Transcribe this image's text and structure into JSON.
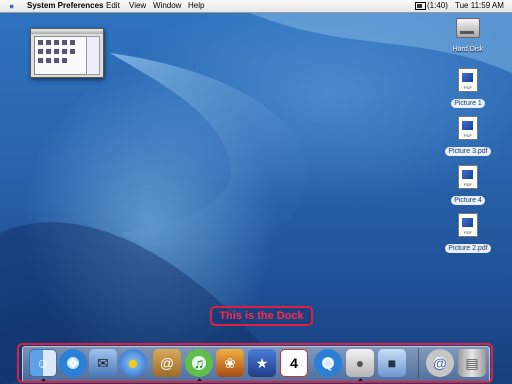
{
  "menubar": {
    "apple_icon": "apple-menu-icon",
    "app_name": "System Preferences",
    "menus": [
      "Edit",
      "View",
      "Window",
      "Help"
    ],
    "battery": "(1:40)",
    "clock": "Tue 11:59 AM"
  },
  "desktop": {
    "icons": [
      {
        "label": "Hard Disk",
        "kind": "hard-disk-icon"
      },
      {
        "label": "Picture 1",
        "kind": "pdf-file-icon"
      },
      {
        "label": "Picture 3.pdf",
        "kind": "pdf-file-icon"
      },
      {
        "label": "Picture 4",
        "kind": "pdf-file-icon"
      },
      {
        "label": "Picture 2.pdf",
        "kind": "pdf-file-icon"
      }
    ]
  },
  "callout": {
    "text": "This is the Dock",
    "color": "#e0203c"
  },
  "dock": {
    "apps": [
      "finder-icon",
      "safari-icon",
      "mail-icon",
      "ichat-icon",
      "address-book-icon",
      "itunes-icon",
      "iphoto-icon",
      "imovie-icon",
      "ical-icon",
      "quicktime-icon",
      "system-preferences-icon",
      "preview-icon"
    ],
    "right": [
      "internet-location-icon",
      "trash-icon"
    ]
  }
}
